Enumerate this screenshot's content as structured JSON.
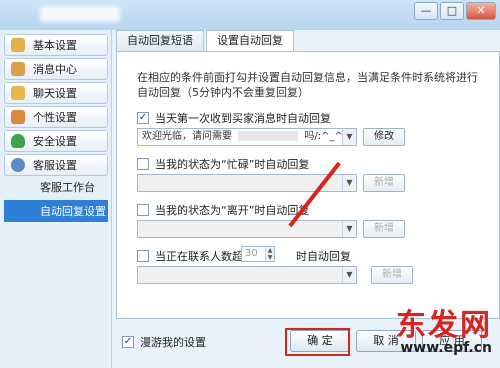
{
  "window": {
    "buttons": [
      {
        "name": "minimize-button",
        "label": "—"
      },
      {
        "name": "maximize-button",
        "label": "□"
      },
      {
        "name": "close-button",
        "label": "✕"
      }
    ]
  },
  "sidebar": {
    "items": [
      {
        "label": "基本设置",
        "icon": "settings-icon",
        "color": "#e2b04a"
      },
      {
        "label": "消息中心",
        "icon": "envelope-icon",
        "color": "#d9a24a"
      },
      {
        "label": "聊天设置",
        "icon": "chat-icon",
        "color": "#e8b84c"
      },
      {
        "label": "个性设置",
        "icon": "personal-icon",
        "color": "#d68c3a"
      },
      {
        "label": "安全设置",
        "icon": "shield-icon",
        "color": "#3da44b"
      },
      {
        "label": "客服设置",
        "icon": "service-icon",
        "color": "#5c88c6"
      }
    ],
    "subitems": [
      {
        "label": "客服工作台",
        "active": false
      },
      {
        "label": "自动回复设置",
        "active": true
      }
    ]
  },
  "tabs": [
    {
      "label": "自动回复短语",
      "active": false
    },
    {
      "label": "设置自动回复",
      "active": true
    }
  ],
  "panel": {
    "description": "在相应的条件前面打勾并设置自动回复信息，当满足条件时系统将进行自动回复（5分钟内不会重复回复）",
    "rules": [
      {
        "checked": true,
        "label": "当天第一次收到买家消息时自动回复",
        "combo_value": "欢迎光临，请问需要",
        "combo_value_right": "吗/:^_^",
        "button": "修改",
        "button_disabled": false,
        "check_mark": "✓"
      },
      {
        "checked": false,
        "label": "当我的状态为“忙碌”时自动回复",
        "combo_value": "",
        "button": "新增",
        "button_disabled": true
      },
      {
        "checked": false,
        "label": "当我的状态为“离开”时自动回复",
        "combo_value": "",
        "button": "新增",
        "button_disabled": true
      },
      {
        "checked": false,
        "label_prefix": "当正在联系人数超过",
        "spin_value": "30",
        "label_suffix": "时自动回复",
        "combo_value": "",
        "button": "新增",
        "button_disabled": true
      }
    ]
  },
  "footer": {
    "roam_checked": true,
    "roam_label": "漫游我的设置",
    "confirm_label": "确 定",
    "cancel_label": "取 消",
    "apply_label": "应 用"
  },
  "watermark": {
    "text": "东发网",
    "url": "www.epf.cn"
  }
}
